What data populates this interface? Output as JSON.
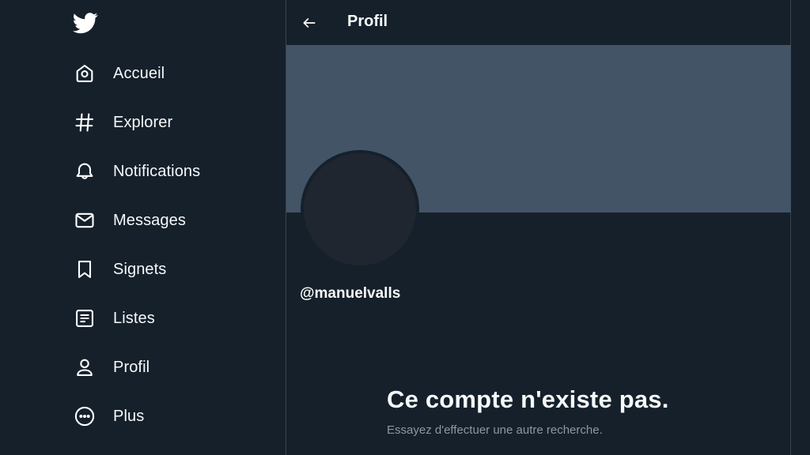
{
  "sidebar": {
    "logo_icon": "twitter-bird-icon",
    "items": [
      {
        "label": "Accueil",
        "icon": "home-icon"
      },
      {
        "label": "Explorer",
        "icon": "hashtag-icon"
      },
      {
        "label": "Notifications",
        "icon": "bell-icon"
      },
      {
        "label": "Messages",
        "icon": "envelope-icon"
      },
      {
        "label": "Signets",
        "icon": "bookmark-icon"
      },
      {
        "label": "Listes",
        "icon": "list-icon"
      },
      {
        "label": "Profil",
        "icon": "person-icon"
      },
      {
        "label": "Plus",
        "icon": "more-circle-icon"
      }
    ]
  },
  "header": {
    "back_icon": "arrow-left-icon",
    "title": "Profil"
  },
  "profile": {
    "handle": "@manuelvalls"
  },
  "empty_state": {
    "title": "Ce compte n'existe pas.",
    "subtitle": "Essayez d'effectuer une autre recherche."
  },
  "colors": {
    "background": "#15202b",
    "banner": "#425466",
    "avatar": "#1f2630",
    "text_primary": "#f7f9f9",
    "text_secondary": "#8b98a5",
    "border": "#38444d"
  }
}
